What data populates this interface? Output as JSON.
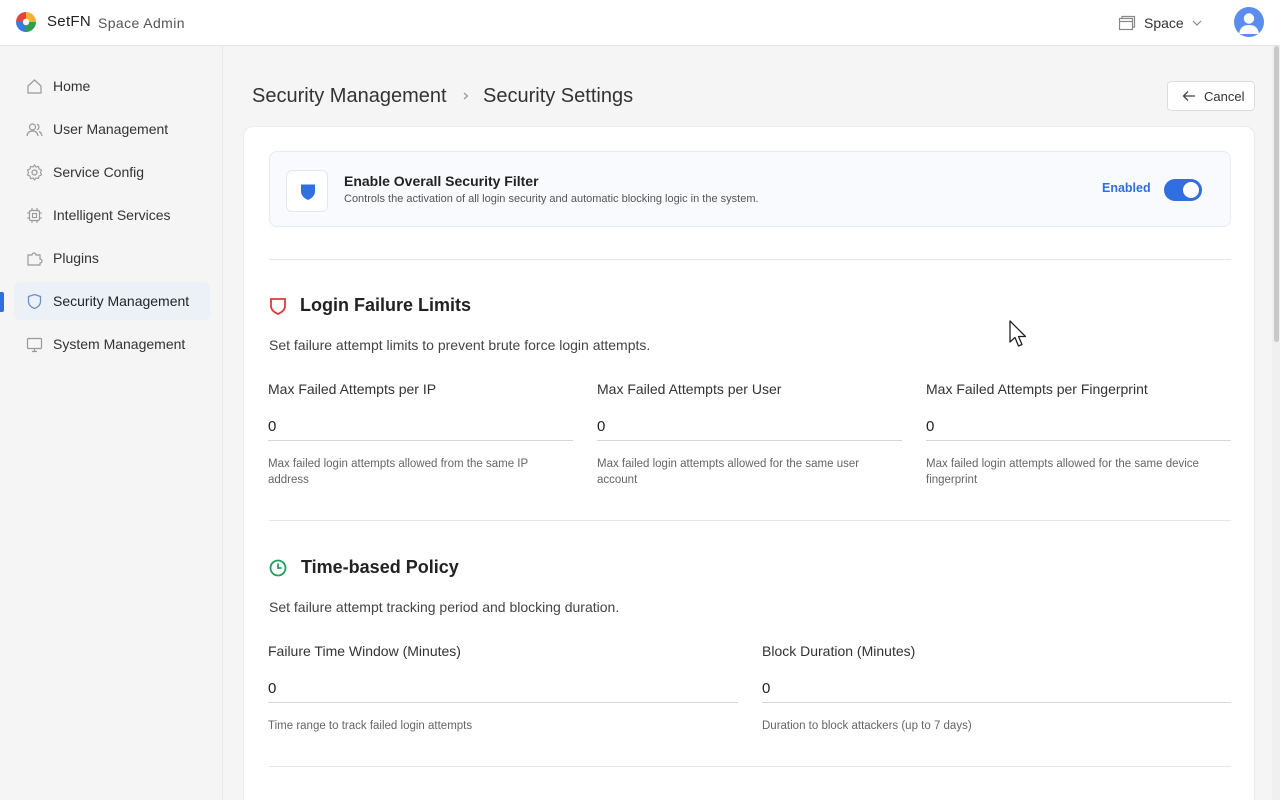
{
  "header": {
    "brand": "SetFN",
    "subtitle": "Space Admin",
    "space_label": "Space",
    "icons": {
      "logo": "setfn-logo-icon",
      "space": "space-icon",
      "chevron": "chevron-down-icon",
      "avatar": "user-avatar-icon"
    }
  },
  "sidebar": {
    "items": [
      {
        "label": "Home",
        "icon": "home-icon"
      },
      {
        "label": "User Management",
        "icon": "users-icon"
      },
      {
        "label": "Service Config",
        "icon": "gear-icon"
      },
      {
        "label": "Intelligent Services",
        "icon": "chip-icon"
      },
      {
        "label": "Plugins",
        "icon": "puzzle-icon"
      },
      {
        "label": "Security Management",
        "icon": "shield-icon",
        "active": true
      },
      {
        "label": "System Management",
        "icon": "monitor-icon"
      }
    ]
  },
  "breadcrumb": {
    "parent": "Security Management",
    "current": "Security Settings"
  },
  "cancel_label": "Cancel",
  "filter": {
    "title": "Enable Overall Security Filter",
    "description": "Controls the activation of all login security and automatic blocking logic in the system.",
    "status_label": "Enabled",
    "enabled": true
  },
  "login_limits": {
    "title": "Login Failure Limits",
    "description": "Set failure attempt limits to prevent brute force login attempts.",
    "fields": [
      {
        "label": "Max Failed Attempts per IP",
        "value": "0",
        "help": "Max failed login attempts allowed from the same IP address"
      },
      {
        "label": "Max Failed Attempts per User",
        "value": "0",
        "help": "Max failed login attempts allowed for the same user account"
      },
      {
        "label": "Max Failed Attempts per Fingerprint",
        "value": "0",
        "help": "Max failed login attempts allowed for the same device fingerprint"
      }
    ]
  },
  "time_policy": {
    "title": "Time-based Policy",
    "description": "Set failure attempt tracking period and blocking duration.",
    "fields": [
      {
        "label": "Failure Time Window (Minutes)",
        "value": "0",
        "help": "Time range to track failed login attempts"
      },
      {
        "label": "Block Duration (Minutes)",
        "value": "0",
        "help": "Duration to block attackers (up to 7 days)"
      }
    ]
  },
  "colors": {
    "accent": "#2f6fdf",
    "shield_red": "#e03b3b",
    "clock_green": "#22a05a"
  }
}
